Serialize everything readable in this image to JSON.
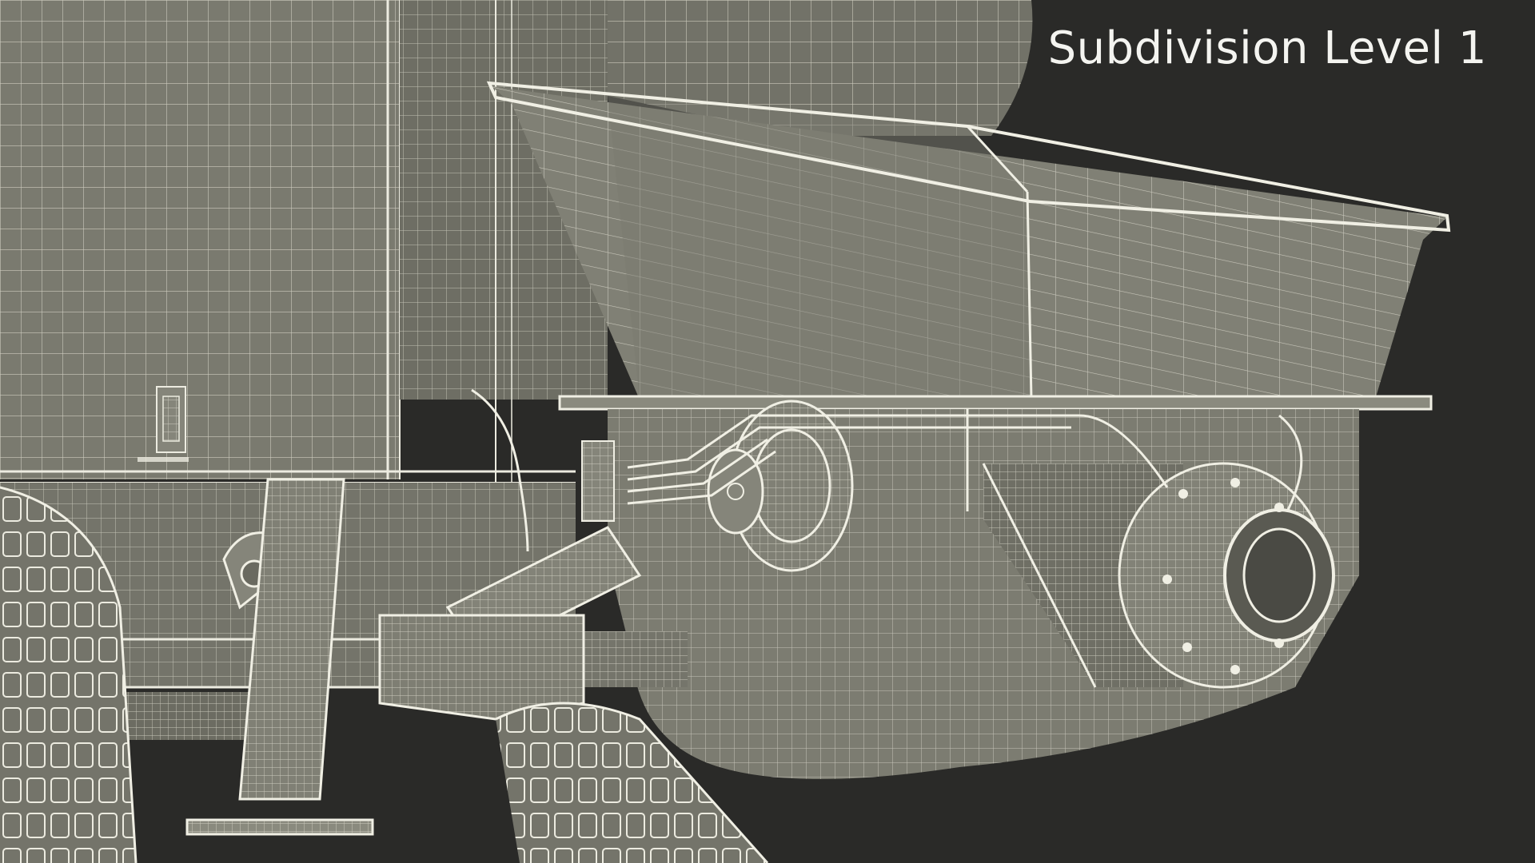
{
  "overlay": {
    "label": "Subdivision Level 1"
  },
  "scene": {
    "subject": "wireframe render of trailer concrete pump hopper and chassis",
    "colors": {
      "background": "#2a2a28",
      "surface": "#7e7e72",
      "surface_dark": "#6a6a60",
      "wire": "#ecebe0",
      "label": "#f4f4f0"
    }
  }
}
